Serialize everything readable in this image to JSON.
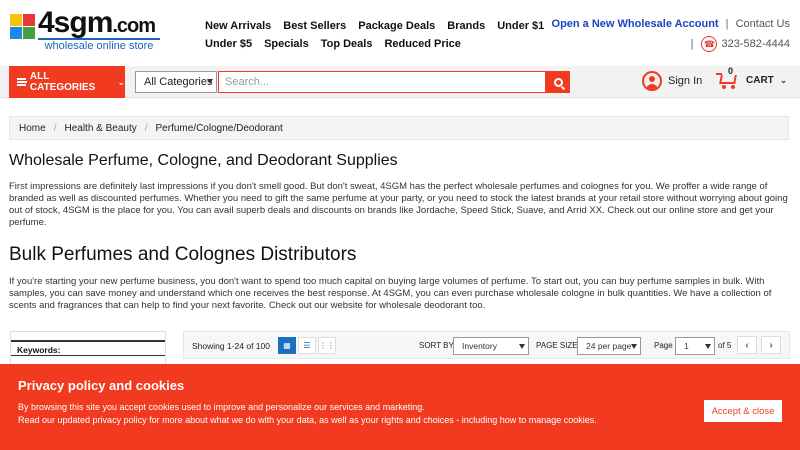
{
  "logo": {
    "text": "4sgm",
    "dotcom": ".com",
    "tagline": "wholesale online store"
  },
  "nav": {
    "row1": [
      "New Arrivals",
      "Best Sellers",
      "Package Deals",
      "Brands",
      "Under $1"
    ],
    "row2": [
      "Under $5",
      "Specials",
      "Top Deals",
      "Reduced Price"
    ]
  },
  "header_links": {
    "wholesale": "Open a New Wholesale Account",
    "separator": "|",
    "contact": "Contact Us",
    "phone": "323-582-4444"
  },
  "search_bar": {
    "all_categories": "ALL CATEGORIES",
    "category_select": "All Categories",
    "placeholder": "Search...",
    "signin": "Sign In",
    "cart_label": "CART",
    "cart_count": "0"
  },
  "breadcrumb": [
    "Home",
    "Health & Beauty",
    "Perfume/Cologne/Deodorant"
  ],
  "breadcrumb_separator": "/",
  "content": {
    "heading1": "Wholesale Perfume, Cologne, and Deodorant Supplies",
    "paragraph1": "First impressions are definitely last impressions if you don't smell good. But don't sweat, 4SGM has the perfect wholesale perfumes and colognes for you. We proffer a wide range of branded as well as discounted perfumes. Whether you need to gift the same perfume at your party, or you need to stock the latest brands at your retail store without worrying about going out of stock, 4SGM is the place for you. You can avail superb deals and discounts on brands like Jordache, Speed Stick, Suave, and Arrid XX. Check out our online store and get your perfume.",
    "heading2": "Bulk Perfumes and Colognes Distributors",
    "paragraph2": "If you're starting your new perfume business, you don't want to spend too much capital on buying large volumes of perfume. To start out, you can buy perfume samples in bulk. With samples, you can save money and understand which one receives the best response. At 4SGM, you can even purchase wholesale cologne in bulk quantities. We have a collection of scents and fragrances that can help to find your next favorite. Check out our website for wholesale deodorant too."
  },
  "sidebar": {
    "keywords_label": "Keywords:"
  },
  "toolbar": {
    "showing": "Showing 1-24 of 100",
    "sort_by_label": "SORT BY",
    "sort_by_value": "Inventory",
    "page_size_label": "PAGE SIZE",
    "page_size_value": "24 per page",
    "page_label": "Page",
    "page_value": "1",
    "page_total": "of 5",
    "prev": "‹",
    "next": "›"
  },
  "cookie": {
    "title": "Privacy policy and cookies",
    "line1": "By browsing this site you accept cookies used to improve and personalize our services and marketing.",
    "line2": "Read our updated privacy policy for more about what we do with your data, as well as your rights and choices - including how to manage cookies.",
    "button": "Accept & close"
  },
  "colors": {
    "accent": "#f13a1f",
    "link_blue": "#1a44c2",
    "view_blue": "#1a6fc2"
  }
}
